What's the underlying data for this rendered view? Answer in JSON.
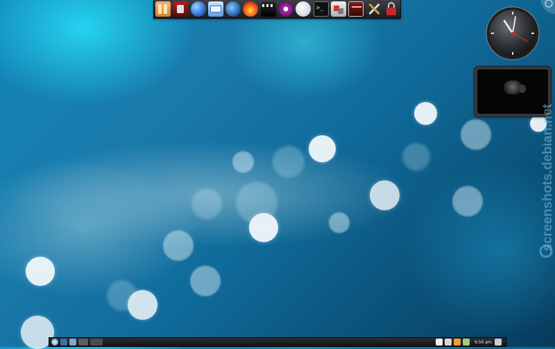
{
  "desktop": {
    "wallpaper": "blue bokeh",
    "colors": {
      "bg_light": "#29e1fa",
      "bg_dark": "#073b5c",
      "bokeh": "#f5fafc"
    }
  },
  "launcher": {
    "icons": [
      "file-manager-icon",
      "music-player-icon",
      "web-browser-icon",
      "mail-icon",
      "compass-browser-icon",
      "fire-app-icon",
      "video-editor-icon",
      "media-eye-icon",
      "paper-icon",
      "terminal-icon",
      "software-package-icon",
      "presentation-icon",
      "settings-tools-icon",
      "lock-icon"
    ]
  },
  "clock_widget": {
    "icon": "analog-clock-icon"
  },
  "video_widget": {
    "icon": "video-player-icon"
  },
  "watermark": {
    "text": "screenshots.debian.net"
  },
  "taskbar": {
    "clock_text": "9:56 pm",
    "left_icons": [
      "start-menu-icon",
      "pager-icon",
      "home-icon",
      "app-icon",
      "window-icon"
    ],
    "tray_icons": [
      "clipboard-icon",
      "volume-icon",
      "network-icon",
      "battery-icon"
    ]
  }
}
